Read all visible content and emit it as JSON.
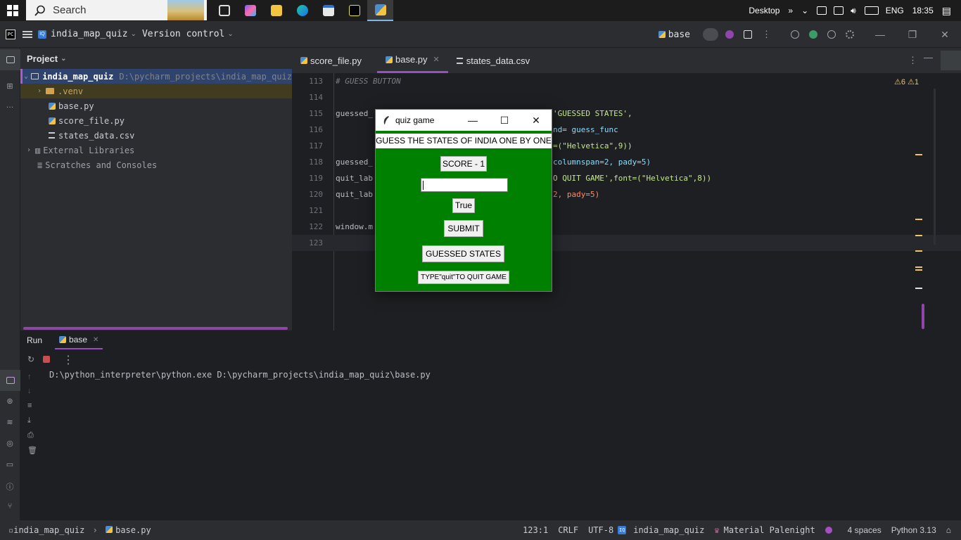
{
  "taskbar": {
    "search_placeholder": "Search",
    "desktop_label": "Desktop",
    "lang": "ENG",
    "time": "18:35",
    "app_icons": [
      "task-view",
      "copilot",
      "file-explorer",
      "edge",
      "store",
      "pycharm",
      "python-idle"
    ]
  },
  "ide": {
    "project_name": "india_map_quiz",
    "vcs_label": "Version control",
    "run_config": "base",
    "project_panel": {
      "title": "Project",
      "root_name": "india_map_quiz",
      "root_path": "D:\\pycharm_projects\\india_map_quiz",
      "items": [
        {
          "name": ".venv",
          "kind": "folder"
        },
        {
          "name": "base.py",
          "kind": "python"
        },
        {
          "name": "score_file.py",
          "kind": "python"
        },
        {
          "name": "states_data.csv",
          "kind": "csv"
        }
      ],
      "external": "External Libraries",
      "scratches": "Scratches and Consoles"
    },
    "tabs": [
      {
        "label": "score_file.py",
        "active": false
      },
      {
        "label": "base.py",
        "active": true
      },
      {
        "label": "states_data.csv",
        "active": false
      }
    ],
    "editor": {
      "warnings": "⚠6 ⚠1",
      "lines": [
        {
          "num": "113",
          "left": "# GUESS BUTTON",
          "right": ""
        },
        {
          "num": "114",
          "left": "",
          "right": ""
        },
        {
          "num": "115",
          "left": "guessed_",
          "right": "'GUESSED STATES',"
        },
        {
          "num": "116",
          "left": "",
          "right": "nd= guess_func"
        },
        {
          "num": "117",
          "left": "",
          "right": "=(\"Helvetica\",9))"
        },
        {
          "num": "118",
          "left": "guessed_",
          "right": "columnspan=2, pady=5)"
        },
        {
          "num": "119",
          "left": "quit_lab",
          "right": "O QUIT GAME',font=(\"Helvetica\",8))"
        },
        {
          "num": "120",
          "left": "quit_lab",
          "right": "2, pady=5)"
        },
        {
          "num": "121",
          "left": "",
          "right": ""
        },
        {
          "num": "122",
          "left": "window.m",
          "right": ""
        },
        {
          "num": "123",
          "left": "",
          "right": ""
        }
      ]
    },
    "run_panel": {
      "title": "Run",
      "tab": "base",
      "console_line": "D:\\python_interpreter\\python.exe D:\\pycharm_projects\\india_map_quiz\\base.py"
    },
    "status_bar": {
      "breadcrumb_project": "india_map_quiz",
      "breadcrumb_file": "base.py",
      "position": "123:1",
      "line_ending": "CRLF",
      "encoding": "UTF-8",
      "project": "india_map_quiz",
      "theme": "Material Palenight",
      "indent": "4 spaces",
      "interpreter": "Python 3.13"
    }
  },
  "quiz_window": {
    "title": "quiz game",
    "heading": "GUESS THE STATES OF INDIA ONE BY ONE",
    "score": "SCORE - 1",
    "entry_value": "",
    "result": "True",
    "submit": "SUBMIT",
    "guessed": "GUESSED STATES",
    "quit_hint": "TYPE\"quit\"TO QUIT GAME",
    "bg_color": "#008000"
  }
}
